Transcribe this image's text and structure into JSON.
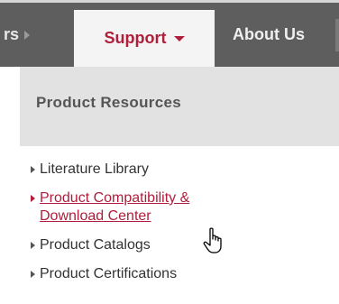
{
  "nav": {
    "prev_label": "rs",
    "active_label": "Support",
    "next_label": "About Us"
  },
  "panel": {
    "title": "Product Resources",
    "links": [
      {
        "label": "Literature Library",
        "active": false
      },
      {
        "label": "Product Compatibility & Download Center",
        "active": true
      },
      {
        "label": "Product Catalogs",
        "active": false
      },
      {
        "label": "Product Certifications",
        "active": false
      }
    ]
  },
  "colors": {
    "nav_bg": "#5e5e5e",
    "accent": "#b01e3c",
    "panel_header_bg": "#e2e2e2"
  },
  "icons": {
    "cursor": "hand-pointer-icon",
    "bullet": "triangle-right-icon",
    "dropdown": "caret-down-icon"
  }
}
